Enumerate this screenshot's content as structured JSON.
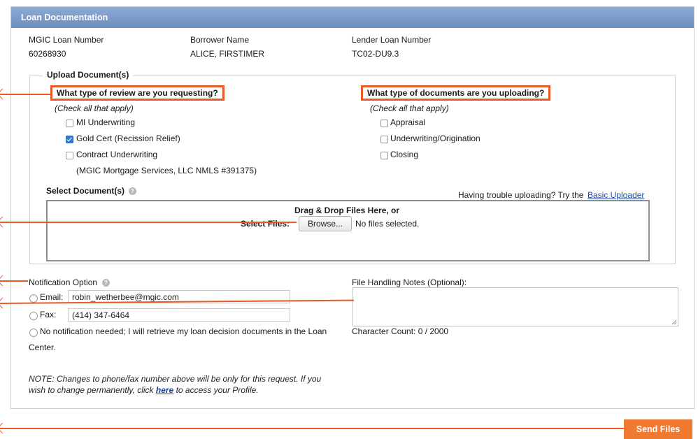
{
  "header": {
    "title": "Loan Documentation"
  },
  "loan": {
    "mgic_label": "MGIC Loan Number",
    "mgic_value": "60268930",
    "borrower_label": "Borrower Name",
    "borrower_value": "ALICE, FIRSTIMER",
    "lender_label": "Lender Loan Number",
    "lender_value": "TC02-DU9.3"
  },
  "upload": {
    "legend": "Upload Document(s)",
    "review": {
      "question": "What type of review are you requesting?",
      "hint": "(Check all that apply)",
      "options": [
        {
          "label": "MI Underwriting",
          "checked": false
        },
        {
          "label": "Gold Cert (Recission Relief)",
          "checked": true
        },
        {
          "label": "Contract Underwriting",
          "checked": false
        }
      ],
      "footnote": "(MGIC Mortgage Services, LLC NMLS #391375)"
    },
    "documents": {
      "question": "What type of documents are you uploading?",
      "hint": "(Check all that apply)",
      "options": [
        {
          "label": "Appraisal",
          "checked": false
        },
        {
          "label": "Underwriting/Origination",
          "checked": false
        },
        {
          "label": "Closing",
          "checked": false
        }
      ]
    },
    "select_label": "Select Document(s)",
    "trouble_text": "Having trouble uploading? Try the",
    "basic_uploader_link": "Basic Uploader",
    "drop_text": "Drag & Drop Files Here, or",
    "select_files_label": "Select Files:",
    "browse_label": "Browse...",
    "no_files_text": "No files selected."
  },
  "notification": {
    "title": "Notification Option",
    "email_label": "Email:",
    "email_value": "robin_wetherbee@mgic.com",
    "fax_label": "Fax:",
    "fax_value": "(414) 347-6464",
    "none_line1": "No notification needed; I will retrieve my loan decision documents in the Loan",
    "none_line2": "Center.",
    "note_before": "NOTE: Changes to phone/fax number above will be only for this request. If you wish to change permanently, click ",
    "note_link": "here",
    "note_after": " to access your Profile."
  },
  "notes": {
    "label": "File Handling Notes (Optional):",
    "char_count": "Character Count: 0 / 2000"
  },
  "actions": {
    "send_label": "Send Files"
  },
  "colors": {
    "accent": "#e85b25",
    "header": "#7a97c8",
    "checked": "#2f7fd3"
  },
  "icons": [
    "help-icon",
    "checkbox-icon",
    "radio-icon",
    "pointer-arrow-icon"
  ]
}
